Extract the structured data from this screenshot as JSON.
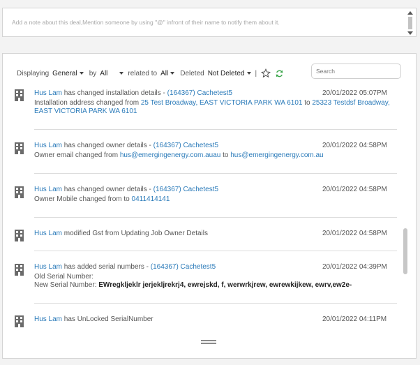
{
  "note": {
    "placeholder": "Add a note about this deal,Mention someone by using \"@\" infront of their name to notify them about it."
  },
  "filters": {
    "displaying_label": "Displaying",
    "displaying_value": "General",
    "by_label": "by",
    "by_value": "All",
    "related_label": "related to",
    "related_value": "All",
    "deleted_label": "Deleted",
    "deleted_value": "Not Deleted",
    "separator": "|",
    "search_placeholder": "Search"
  },
  "activities": [
    {
      "user": "Hus Lam",
      "action": " has changed installation details - ",
      "ref": "(164367) Cachetest5",
      "timestamp": "20/01/2022 05:07PM",
      "detail_prefix": "Installation address changed from ",
      "detail_from": "25 Test Broadway, EAST VICTORIA PARK WA 6101",
      "detail_mid": " to ",
      "detail_to_a": "25323 Testdsf Broadway,",
      "detail_to_b": "EAST VICTORIA PARK WA 6101"
    },
    {
      "user": "Hus Lam",
      "action": " has changed owner details - ",
      "ref": "(164367) Cachetest5",
      "timestamp": "20/01/2022 04:58PM",
      "detail_prefix": "Owner email changed from ",
      "detail_from": "hus@emergingenergy.com.auau",
      "detail_mid": " to ",
      "detail_to": "hus@emergingenergy.com.au"
    },
    {
      "user": "Hus Lam",
      "action": " has changed owner details - ",
      "ref": "(164367) Cachetest5",
      "timestamp": "20/01/2022 04:58PM",
      "detail_prefix": "Owner Mobile changed from to ",
      "detail_to": "0411414141"
    },
    {
      "user": "Hus Lam",
      "action": " modified Gst from Updating Job Owner Details",
      "timestamp": "20/01/2022 04:58PM"
    },
    {
      "user": "Hus Lam",
      "action": " has added serial numbers - ",
      "ref": "(164367) Cachetest5",
      "timestamp": "20/01/2022 04:39PM",
      "old_label": "Old Serial Number:",
      "new_label": "New Serial Number: ",
      "new_value": "EWregkljeklr jerjekljrekrj4, ewrejskd, f, werwrkjrew, ewrewkijkew, ewrv,ew2e-"
    },
    {
      "user": "Hus Lam",
      "action": " has UnLocked SerialNumber",
      "timestamp": "20/01/2022 04:11PM"
    }
  ]
}
